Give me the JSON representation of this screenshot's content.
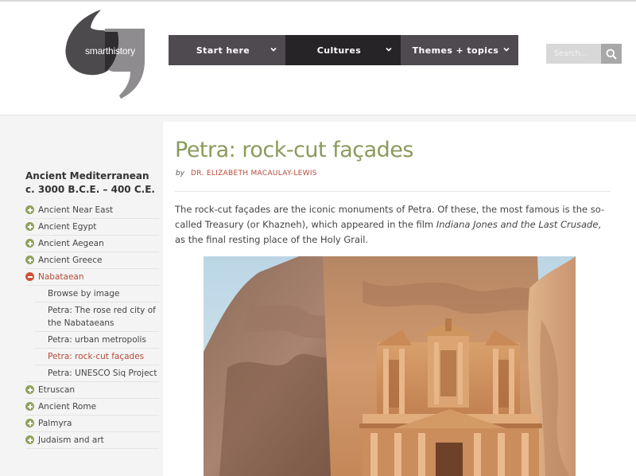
{
  "header": {
    "logo_text": "smarthistory",
    "nav": [
      {
        "label": "Start here"
      },
      {
        "label": "Cultures"
      },
      {
        "label": "Themes + topics"
      }
    ],
    "search": {
      "placeholder": "Search..."
    }
  },
  "sidebar": {
    "heading_line1": "Ancient Mediterranean",
    "heading_line2": "c. 3000 B.C.E. – 400 C.E.",
    "items_before": [
      {
        "label": "Ancient Near East"
      },
      {
        "label": "Ancient Egypt"
      },
      {
        "label": "Ancient Aegean"
      },
      {
        "label": "Ancient Greece"
      }
    ],
    "active_item": {
      "label": "Nabataean"
    },
    "sub_items": [
      {
        "label": "Browse by image"
      },
      {
        "label": "Petra: The rose red city of the Nabataeans"
      },
      {
        "label": "Petra: urban metropolis"
      },
      {
        "label": "Petra: rock-cut façades"
      },
      {
        "label": "Petra: UNESCO Siq Project"
      }
    ],
    "items_after": [
      {
        "label": "Etruscan"
      },
      {
        "label": "Ancient Rome"
      },
      {
        "label": "Palmyra"
      },
      {
        "label": "Judaism and art"
      }
    ]
  },
  "article": {
    "title": "Petra: rock-cut façades",
    "by": "by",
    "author": "DR. ELIZABETH MACAULAY-LEWIS",
    "para_part1": "The rock-cut façades are the iconic monuments of Petra. Of these, the most famous is the so-called Treasury (or Khazneh), which appeared in the film ",
    "para_film": "Indiana Jones and the Last Crusade",
    "para_part2": ", as the final resting place of the Holy Grail."
  },
  "colors": {
    "accent_green": "#8a9a5b",
    "accent_red": "#b34a3a",
    "nav_dark": "#262426",
    "nav_mid": "#4f4a50"
  }
}
